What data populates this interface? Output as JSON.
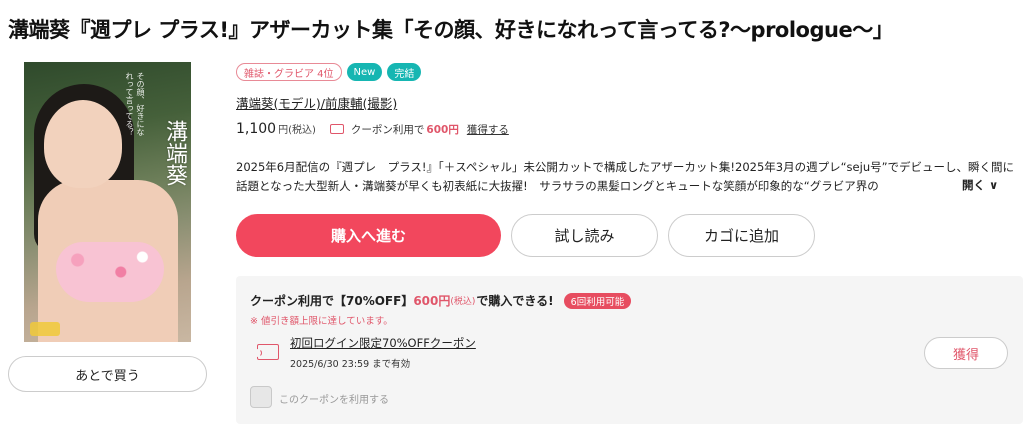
{
  "title": "溝端葵『週プレ プラス!』アザーカット集「その顔、好きになれって言ってる?〜prologue〜」",
  "cover": {
    "title_text": "溝端葵",
    "sub_text": "その顔、好きになれって言ってる？"
  },
  "later_button": "あとで買う",
  "tags": [
    {
      "label": "雑誌・グラビア 4位"
    },
    {
      "label": "New"
    },
    {
      "label": "完結"
    }
  ],
  "author": "溝端葵(モデル)/前康輔(撮影)",
  "price": {
    "amount": "1,100",
    "unit_tax": "円(税込)",
    "coupon_note": "クーポン利用で",
    "coupon_price": "600円",
    "get_link": "獲得する"
  },
  "description": "2025年6月配信の『週プレ　プラス!』「＋スペシャル」未公開カットで構成したアザーカット集!2025年3月の週プレ“seju号”でデビューし、瞬く間に話題となった大型新人・溝端葵が早くも初表紙に大抜擢!　サラサラの黒髪ロングとキュートな笑顔が印象的な“グラビア界の",
  "more_label": "開く ∨",
  "buttons": {
    "buy": "購入へ進む",
    "trial": "試し読み",
    "cart": "カゴに追加"
  },
  "coupon_box": {
    "head_text": "クーポン利用で【70%OFF】",
    "head_price": "600円",
    "head_tax": "(税込)",
    "head_suffix": "で購入できる!",
    "badge": "6回利用可能",
    "warning": "※ 値引き額上限に達しています。",
    "coupon_name": "初回ログイン限定70%OFFクーポン",
    "expiry": "2025/6/30 23:59 まで有効",
    "get_button": "獲得",
    "checkbox_label": "このクーポンを利用する"
  },
  "colors": {
    "accent": "#f2475d",
    "teal": "#16b6b2",
    "coupon_red": "#e0566a"
  }
}
